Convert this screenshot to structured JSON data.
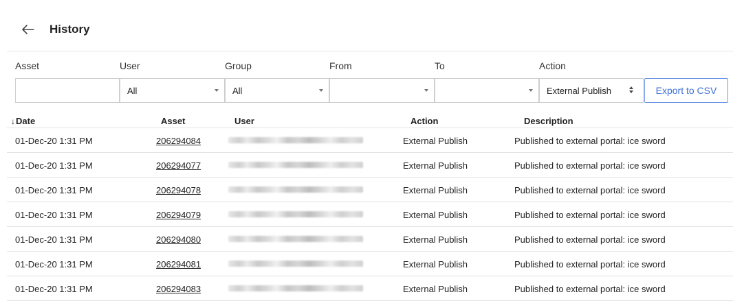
{
  "header": {
    "title": "History"
  },
  "filters": {
    "asset": {
      "label": "Asset",
      "value": ""
    },
    "user": {
      "label": "User",
      "value": "All"
    },
    "group": {
      "label": "Group",
      "value": "All"
    },
    "from": {
      "label": "From",
      "value": ""
    },
    "to": {
      "label": "To",
      "value": ""
    },
    "action": {
      "label": "Action",
      "value": "External Publish"
    },
    "export_label": "Export to CSV"
  },
  "table": {
    "headers": {
      "date": "Date",
      "asset": "Asset",
      "user": "User",
      "action": "Action",
      "description": "Description"
    },
    "sort_indicator": "↓",
    "rows": [
      {
        "date": "01-Dec-20 1:31 PM",
        "asset": "206294084",
        "action": "External Publish",
        "description": "Published to external portal: ice sword"
      },
      {
        "date": "01-Dec-20 1:31 PM",
        "asset": "206294077",
        "action": "External Publish",
        "description": "Published to external portal: ice sword"
      },
      {
        "date": "01-Dec-20 1:31 PM",
        "asset": "206294078",
        "action": "External Publish",
        "description": "Published to external portal: ice sword"
      },
      {
        "date": "01-Dec-20 1:31 PM",
        "asset": "206294079",
        "action": "External Publish",
        "description": "Published to external portal: ice sword"
      },
      {
        "date": "01-Dec-20 1:31 PM",
        "asset": "206294080",
        "action": "External Publish",
        "description": "Published to external portal: ice sword"
      },
      {
        "date": "01-Dec-20 1:31 PM",
        "asset": "206294081",
        "action": "External Publish",
        "description": "Published to external portal: ice sword"
      },
      {
        "date": "01-Dec-20 1:31 PM",
        "asset": "206294083",
        "action": "External Publish",
        "description": "Published to external portal: ice sword"
      }
    ]
  },
  "colors": {
    "accent": "#3d6fd8",
    "border": "#cfcfcf",
    "divider": "#e3e3e3"
  },
  "icons": {
    "back": "arrow-left-icon",
    "sort": "arrow-down-icon"
  }
}
